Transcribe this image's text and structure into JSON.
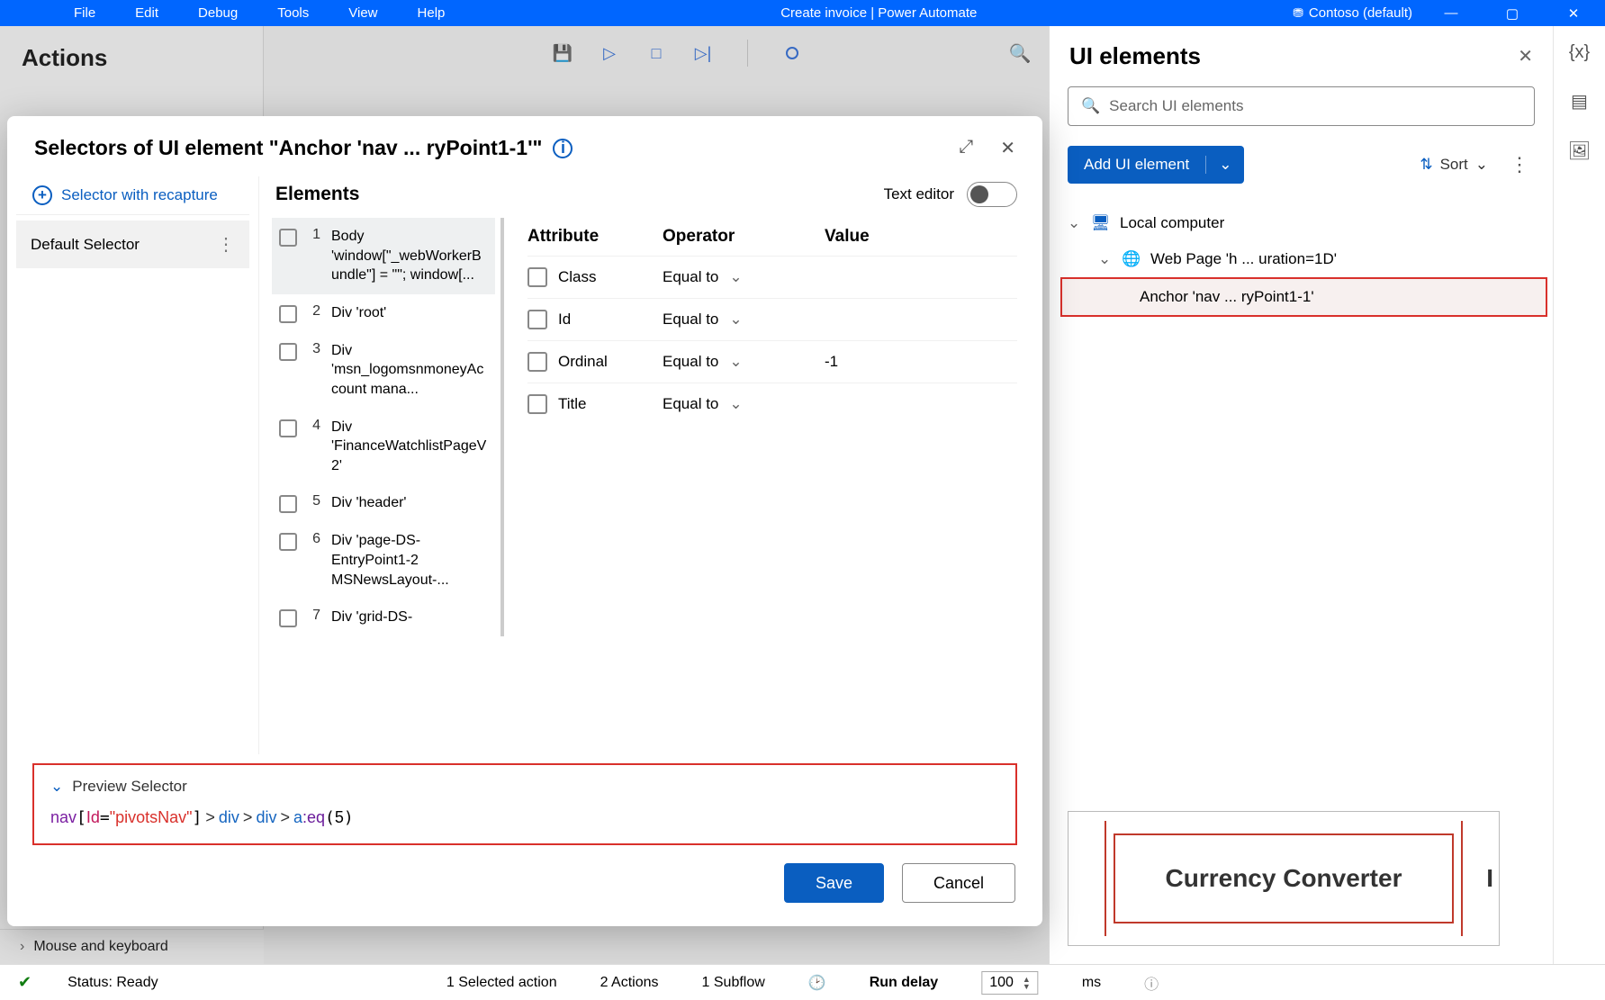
{
  "titlebar": {
    "menus": [
      "File",
      "Edit",
      "Debug",
      "Tools",
      "View",
      "Help"
    ],
    "center": "Create invoice | Power Automate",
    "org": "Contoso (default)"
  },
  "actions": {
    "header": "Actions",
    "mouse_kb": "Mouse and keyboard"
  },
  "uie": {
    "header": "UI elements",
    "search_placeholder": "Search UI elements",
    "add_button": "Add UI element",
    "sort": "Sort",
    "tree": {
      "root": "Local computer",
      "page": "Web Page 'h ... uration=1D'",
      "anchor": "Anchor 'nav ... ryPoint1-1'"
    },
    "thumb_label": "Currency Converter",
    "thumb_cut": "I"
  },
  "modal": {
    "title": "Selectors of UI element \"Anchor 'nav ... ryPoint1-1'\"",
    "recapture": "Selector with recapture",
    "default_selector": "Default Selector",
    "elements_header": "Elements",
    "text_editor": "Text editor",
    "elements": [
      {
        "n": "1",
        "label": "Body 'window[\"_webWorkerBundle\"] = \"\"; window[..."
      },
      {
        "n": "2",
        "label": "Div 'root'"
      },
      {
        "n": "3",
        "label": "Div 'msn_logomsnmoneyAccount mana..."
      },
      {
        "n": "4",
        "label": "Div 'FinanceWatchlistPageV2'"
      },
      {
        "n": "5",
        "label": "Div 'header'"
      },
      {
        "n": "6",
        "label": "Div 'page-DS-EntryPoint1-2 MSNewsLayout-..."
      },
      {
        "n": "7",
        "label": "Div 'grid-DS-"
      }
    ],
    "attr_headers": {
      "a": "Attribute",
      "o": "Operator",
      "v": "Value"
    },
    "attrs": [
      {
        "name": "Class",
        "op": "Equal to",
        "val": ""
      },
      {
        "name": "Id",
        "op": "Equal to",
        "val": ""
      },
      {
        "name": "Ordinal",
        "op": "Equal to",
        "val": "-1"
      },
      {
        "name": "Title",
        "op": "Equal to",
        "val": ""
      }
    ],
    "preview_label": "Preview Selector",
    "selector": {
      "nav": "nav",
      "id_key": "Id",
      "id_val": "\"pivotsNav\"",
      "div": "div",
      "a": "a",
      "eq": ":eq",
      "eq_arg": "5"
    },
    "save": "Save",
    "cancel": "Cancel"
  },
  "status": {
    "ready": "Status: Ready",
    "sel_action": "1 Selected action",
    "actions": "2 Actions",
    "subflow": "1 Subflow",
    "run_delay_label": "Run delay",
    "run_delay_value": "100",
    "ms": "ms"
  }
}
